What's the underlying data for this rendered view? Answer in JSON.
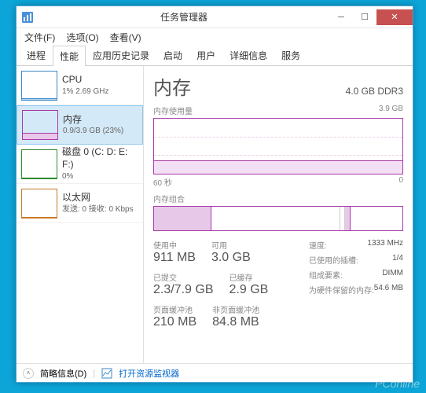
{
  "window": {
    "title": "任务管理器"
  },
  "menu": {
    "file": "文件(F)",
    "options": "选项(O)",
    "view": "查看(V)"
  },
  "tabs": [
    "进程",
    "性能",
    "应用历史记录",
    "启动",
    "用户",
    "详细信息",
    "服务"
  ],
  "sidebar": {
    "cpu": {
      "title": "CPU",
      "sub": "1% 2.69 GHz"
    },
    "mem": {
      "title": "内存",
      "sub": "0.9/3.9 GB (23%)"
    },
    "disk": {
      "title": "磁盘 0 (C: D: E: F:)",
      "sub": "0%"
    },
    "eth": {
      "title": "以太网",
      "sub": "发送: 0 接收: 0 Kbps"
    }
  },
  "main": {
    "heading": "内存",
    "capacity": "4.0 GB DDR3",
    "usage_label": "内存使用量",
    "usage_max": "3.9 GB",
    "x_left": "60 秒",
    "x_right": "0",
    "compo_label": "内存组合",
    "stats": {
      "in_use_lbl": "使用中",
      "in_use": "911 MB",
      "avail_lbl": "可用",
      "avail": "3.0 GB",
      "commit_lbl": "已提交",
      "commit": "2.3/7.9 GB",
      "cached_lbl": "已缓存",
      "cached": "2.9 GB",
      "paged_lbl": "页面缓冲池",
      "paged": "210 MB",
      "nonpaged_lbl": "非页面缓冲池",
      "nonpaged": "84.8 MB"
    },
    "right": {
      "speed_lbl": "速度:",
      "speed": "1333 MHz",
      "slots_lbl": "已使用的插槽:",
      "slots": "1/4",
      "form_lbl": "组成要素:",
      "form": "DIMM",
      "hw_lbl": "为硬件保留的内存:",
      "hw": "54.6 MB"
    }
  },
  "footer": {
    "less": "简略信息(D)",
    "resmon": "打开资源监视器"
  },
  "watermark": "PConline",
  "chart_data": {
    "type": "line",
    "title": "内存使用量",
    "xlabel": "秒",
    "ylabel": "GB",
    "xlim": [
      60,
      0
    ],
    "ylim": [
      0,
      3.9
    ],
    "series": [
      {
        "name": "使用中",
        "approx_value": 0.9
      }
    ]
  }
}
